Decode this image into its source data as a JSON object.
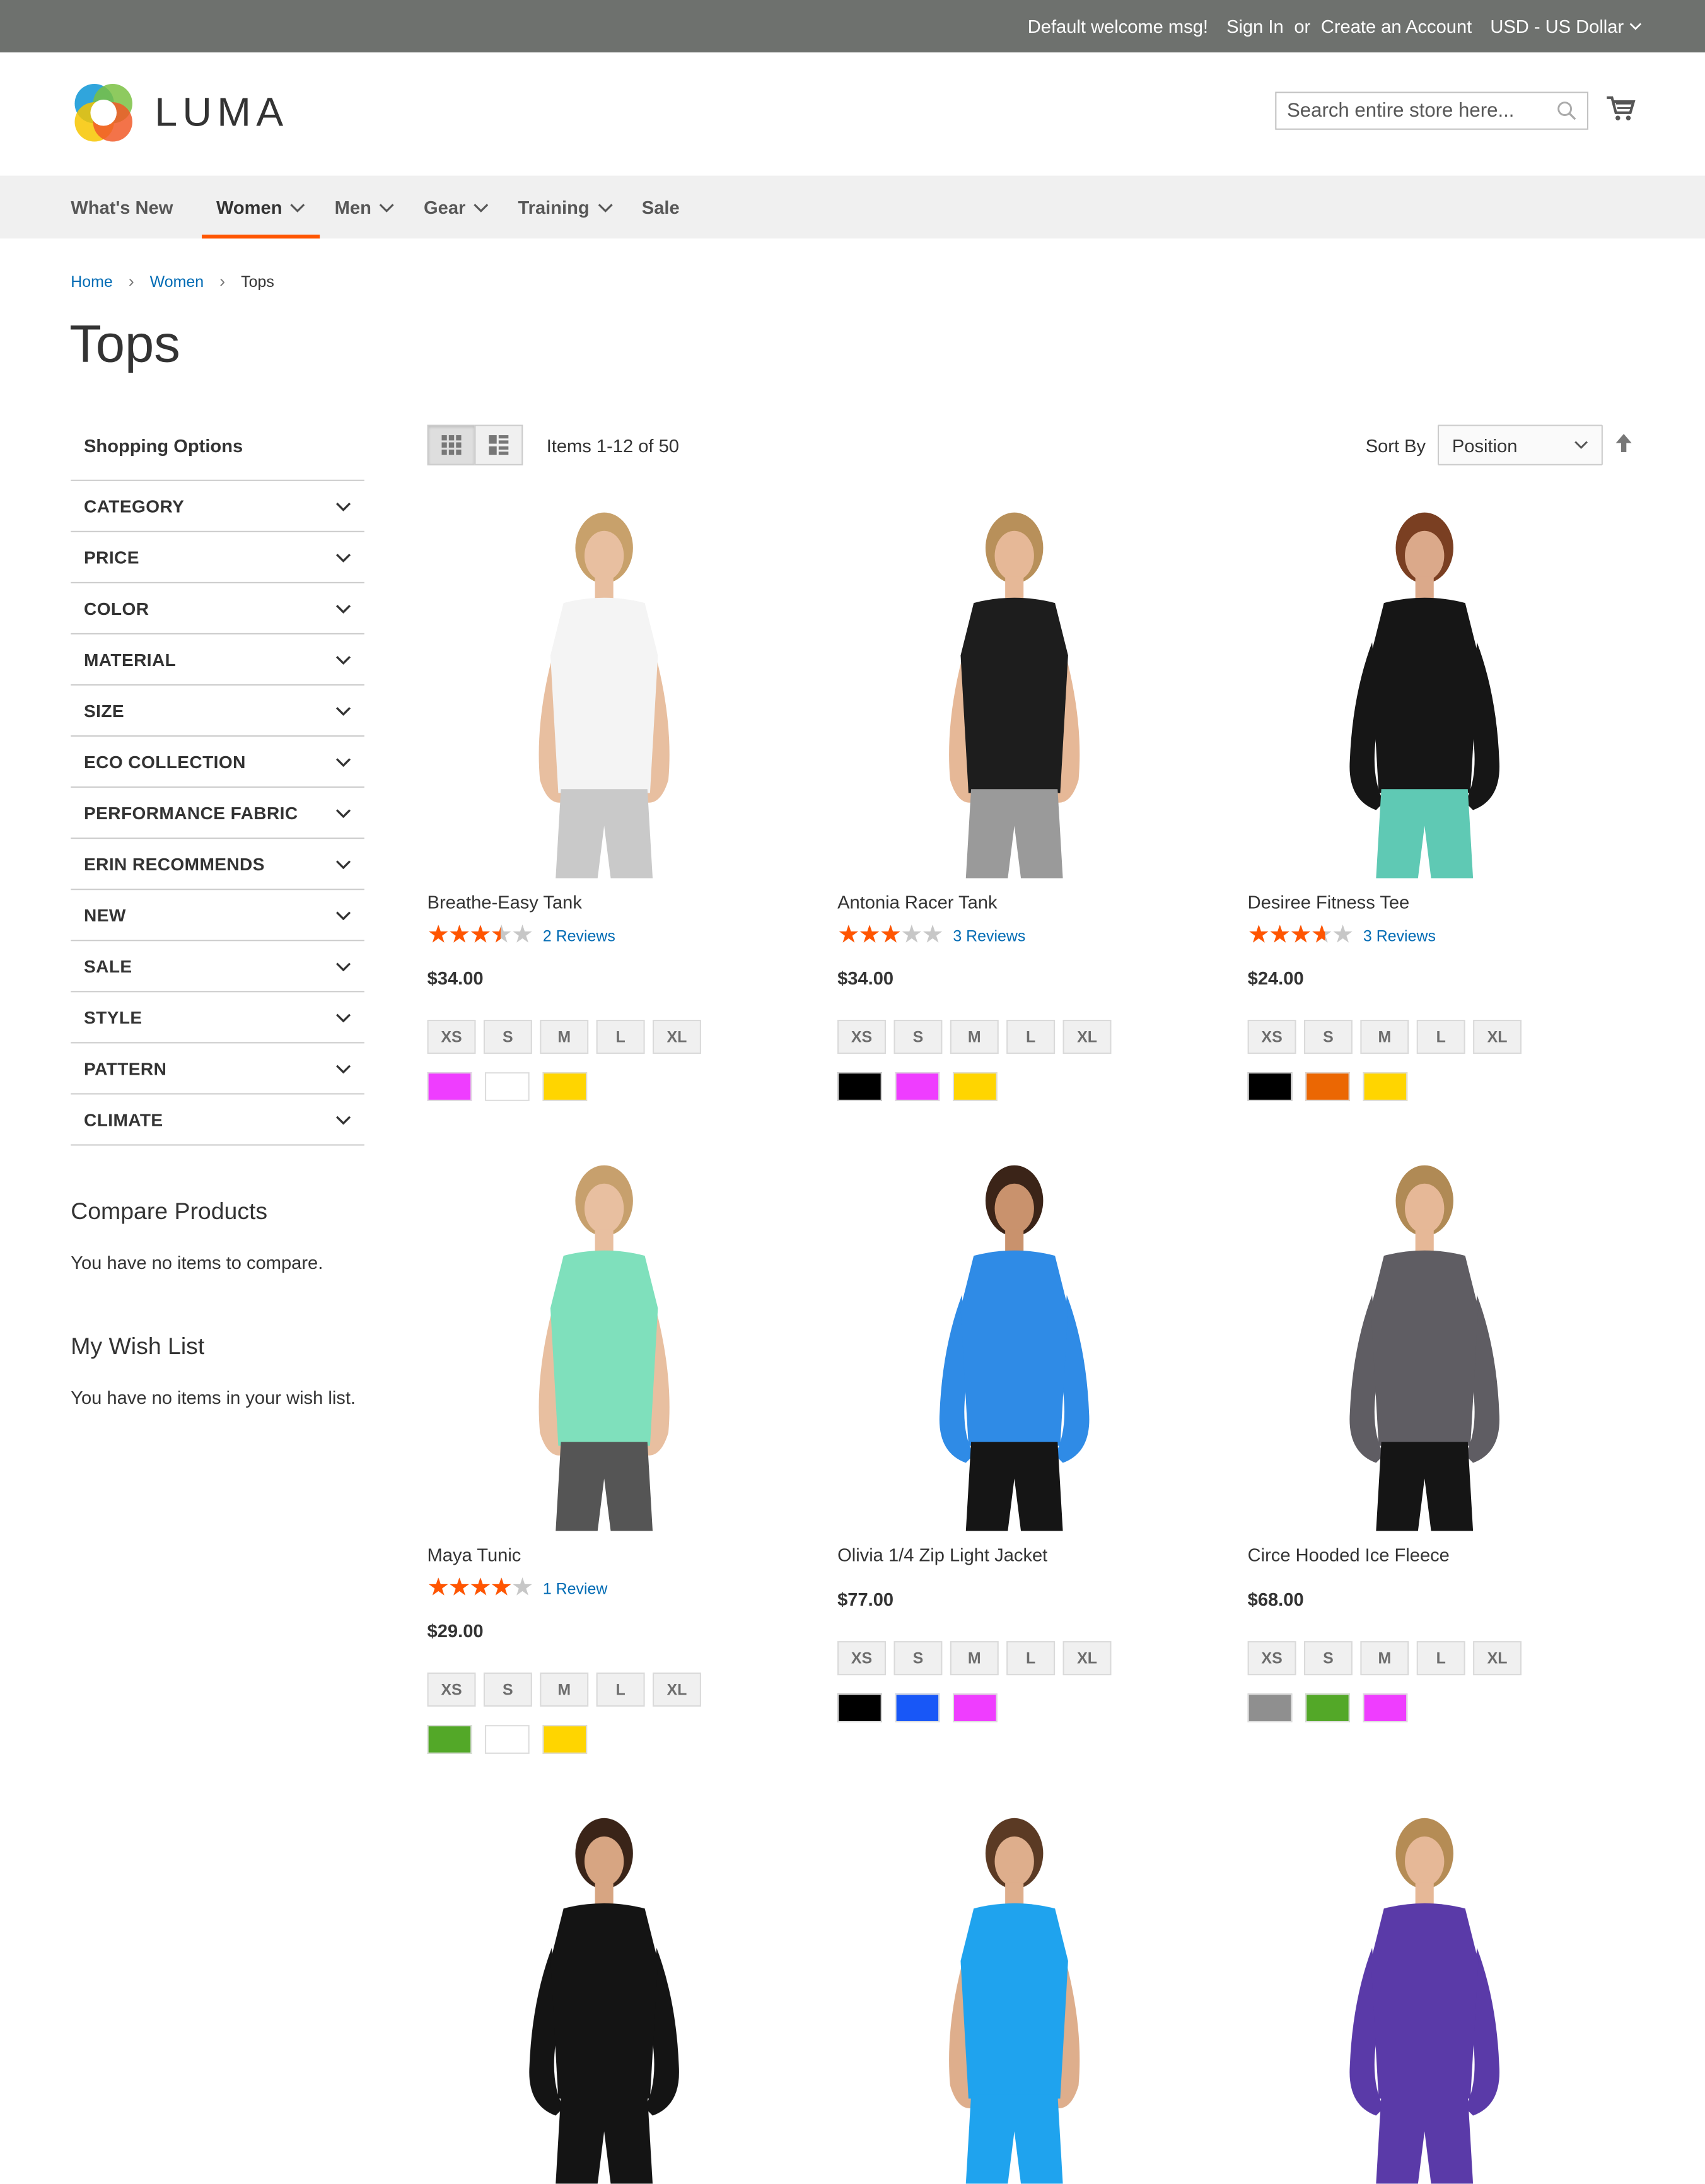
{
  "topbar": {
    "welcome": "Default welcome msg!",
    "sign_in": "Sign In",
    "or": "or",
    "create_account": "Create an Account",
    "currency": "USD - US Dollar"
  },
  "header": {
    "logo_text": "LUMA",
    "search_placeholder": "Search entire store here..."
  },
  "nav": [
    {
      "label": "What's New",
      "dropdown": false,
      "active": false
    },
    {
      "label": "Women",
      "dropdown": true,
      "active": true
    },
    {
      "label": "Men",
      "dropdown": true,
      "active": false
    },
    {
      "label": "Gear",
      "dropdown": true,
      "active": false
    },
    {
      "label": "Training",
      "dropdown": true,
      "active": false
    },
    {
      "label": "Sale",
      "dropdown": false,
      "active": false
    }
  ],
  "breadcrumb": [
    "Home",
    "Women",
    "Tops"
  ],
  "page_title": "Tops",
  "sidebar": {
    "title": "Shopping Options",
    "filters": [
      "CATEGORY",
      "PRICE",
      "COLOR",
      "MATERIAL",
      "SIZE",
      "ECO COLLECTION",
      "PERFORMANCE FABRIC",
      "ERIN RECOMMENDS",
      "NEW",
      "SALE",
      "STYLE",
      "PATTERN",
      "CLIMATE"
    ],
    "compare_title": "Compare Products",
    "compare_text": "You have no items to compare.",
    "wishlist_title": "My Wish List",
    "wishlist_text": "You have no items in your wish list."
  },
  "toolbar": {
    "amount": "Items 1-12 of 50",
    "sort_label": "Sort By",
    "sort_value": "Position"
  },
  "products": [
    {
      "name": "Breathe-Easy Tank",
      "rating": 0.7,
      "reviews": "2  Reviews",
      "price": "$34.00",
      "sizes": [
        "XS",
        "S",
        "M",
        "L",
        "XL"
      ],
      "colors": [
        "#ef3dff",
        "#ffffff",
        "#ffd500"
      ],
      "hair": "#c8a16b",
      "skin": "#e8bfa0",
      "top": "#f4f4f4",
      "bottom": "#c9c9c9",
      "sleeves": false
    },
    {
      "name": "Antonia Racer Tank",
      "rating": 0.6,
      "reviews": "3  Reviews",
      "price": "$34.00",
      "sizes": [
        "XS",
        "S",
        "M",
        "L",
        "XL"
      ],
      "colors": [
        "#000000",
        "#ef3dff",
        "#ffd500"
      ],
      "hair": "#b8905a",
      "skin": "#e6b897",
      "top": "#1d1d1d",
      "bottom": "#9a9a9a",
      "sleeves": false
    },
    {
      "name": "Desiree Fitness Tee",
      "rating": 0.73,
      "reviews": "3  Reviews",
      "price": "$24.00",
      "sizes": [
        "XS",
        "S",
        "M",
        "L",
        "XL"
      ],
      "colors": [
        "#000000",
        "#eb6703",
        "#ffd500"
      ],
      "hair": "#7a3f22",
      "skin": "#dba98a",
      "top": "#161616",
      "bottom": "#5fc9b4",
      "sleeves": true
    },
    {
      "name": "Maya Tunic",
      "rating": 0.8,
      "reviews": "1  Review",
      "price": "$29.00",
      "sizes": [
        "XS",
        "S",
        "M",
        "L",
        "XL"
      ],
      "colors": [
        "#53a828",
        "#ffffff",
        "#ffd500"
      ],
      "hair": "#c7a06d",
      "skin": "#e8bfa0",
      "top": "#7fe0bc",
      "bottom": "#555555",
      "sleeves": false
    },
    {
      "name": "Olivia 1/4 Zip Light Jacket",
      "rating": null,
      "reviews": "",
      "price": "$77.00",
      "sizes": [
        "XS",
        "S",
        "M",
        "L",
        "XL"
      ],
      "colors": [
        "#000000",
        "#1857f7",
        "#ef3dff"
      ],
      "hair": "#3b2418",
      "skin": "#c9926d",
      "top": "#2f8be6",
      "bottom": "#151515",
      "sleeves": true
    },
    {
      "name": "Circe Hooded Ice Fleece",
      "rating": null,
      "reviews": "",
      "price": "$68.00",
      "sizes": [
        "XS",
        "S",
        "M",
        "L",
        "XL"
      ],
      "colors": [
        "#8f8f8f",
        "#53a828",
        "#ef3dff"
      ],
      "hair": "#b08a55",
      "skin": "#e6b897",
      "top": "#5f5d63",
      "bottom": "#151515",
      "sleeves": true
    },
    {
      "name": "",
      "rating": null,
      "reviews": "",
      "price": "",
      "sizes": [],
      "colors": [],
      "hair": "#3a2418",
      "skin": "#d7a582",
      "top": "#141414",
      "bottom": "#141414",
      "sleeves": true
    },
    {
      "name": "",
      "rating": null,
      "reviews": "",
      "price": "",
      "sizes": [],
      "colors": [],
      "hair": "#5b3a24",
      "skin": "#deae8c",
      "top": "#1fa3ee",
      "bottom": "#1fa3ee",
      "sleeves": false
    },
    {
      "name": "",
      "rating": null,
      "reviews": "",
      "price": "",
      "sizes": [],
      "colors": [],
      "hair": "#b58c55",
      "skin": "#e6b897",
      "top": "#5a3aa8",
      "bottom": "#5a3aa8",
      "sleeves": true
    }
  ],
  "colors": {
    "accent": "#ff5501",
    "link": "#006bb4",
    "topbar": "#6e716e",
    "nav_bg": "#f0f0f0"
  }
}
